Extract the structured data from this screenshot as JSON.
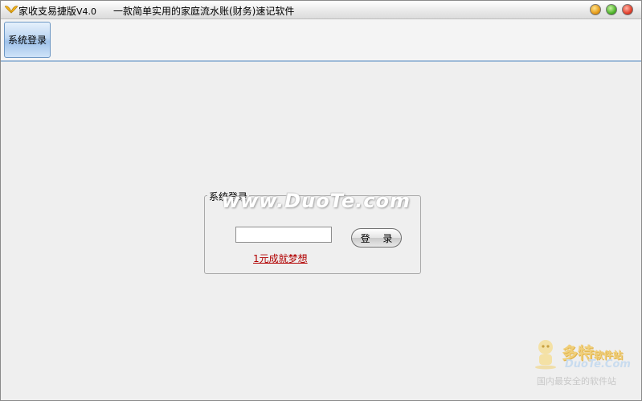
{
  "window": {
    "app_name": "家收支易捷版",
    "version": "V4.0",
    "slogan": "一款简单实用的家庭流水账(财务)速记软件",
    "controls": [
      "minimize-icon",
      "maximize-icon",
      "close-icon"
    ]
  },
  "toolbar": {
    "items": [
      {
        "label": "系统登录",
        "active": true
      }
    ]
  },
  "login": {
    "group_title": "系统登录",
    "password_value": "",
    "login_label": "登 录",
    "promo_link": "1元成就梦想"
  },
  "watermarks": {
    "center_text": "www.DuoTe.com",
    "brand_name": "多特",
    "brand_suffix": "软件站",
    "brand_url": "DuoTe.Com",
    "brand_slogan": "国内最安全的软件站"
  },
  "colors": {
    "toolbar_active": "#bcd6f2",
    "promo_link": "#b10000",
    "window_bg": "#efefef"
  }
}
